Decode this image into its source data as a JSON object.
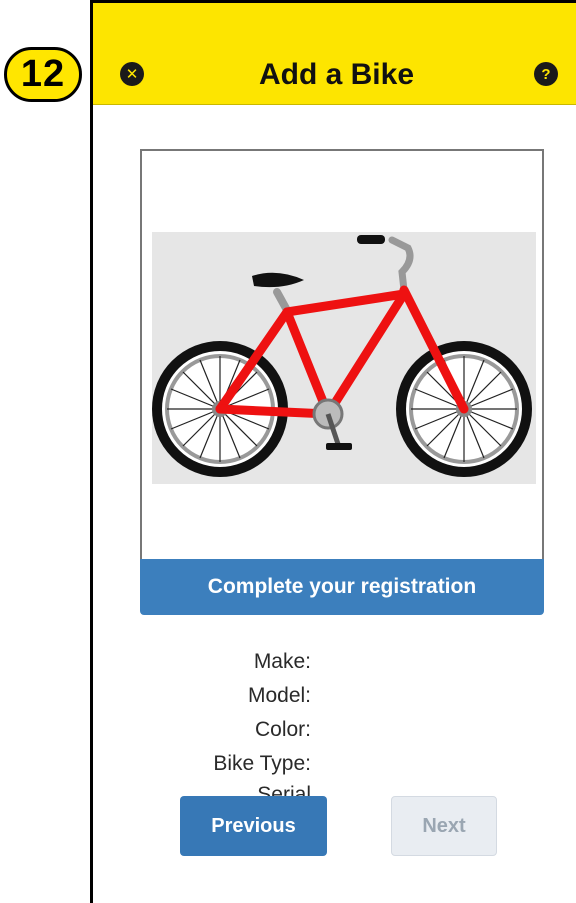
{
  "step_badge": "12",
  "header": {
    "title": "Add a Bike",
    "close_icon": "close-icon",
    "help_icon": "help-icon",
    "background": "#fde500"
  },
  "image_card": {
    "cta": "Complete your registration",
    "cta_color": "#3c7fbd"
  },
  "details": [
    {
      "label": "Make:"
    },
    {
      "label": "Model:"
    },
    {
      "label": "Color:"
    },
    {
      "label": "Bike Type:"
    },
    {
      "label": "Serial"
    }
  ],
  "buttons": {
    "previous": "Previous",
    "next": "Next"
  }
}
